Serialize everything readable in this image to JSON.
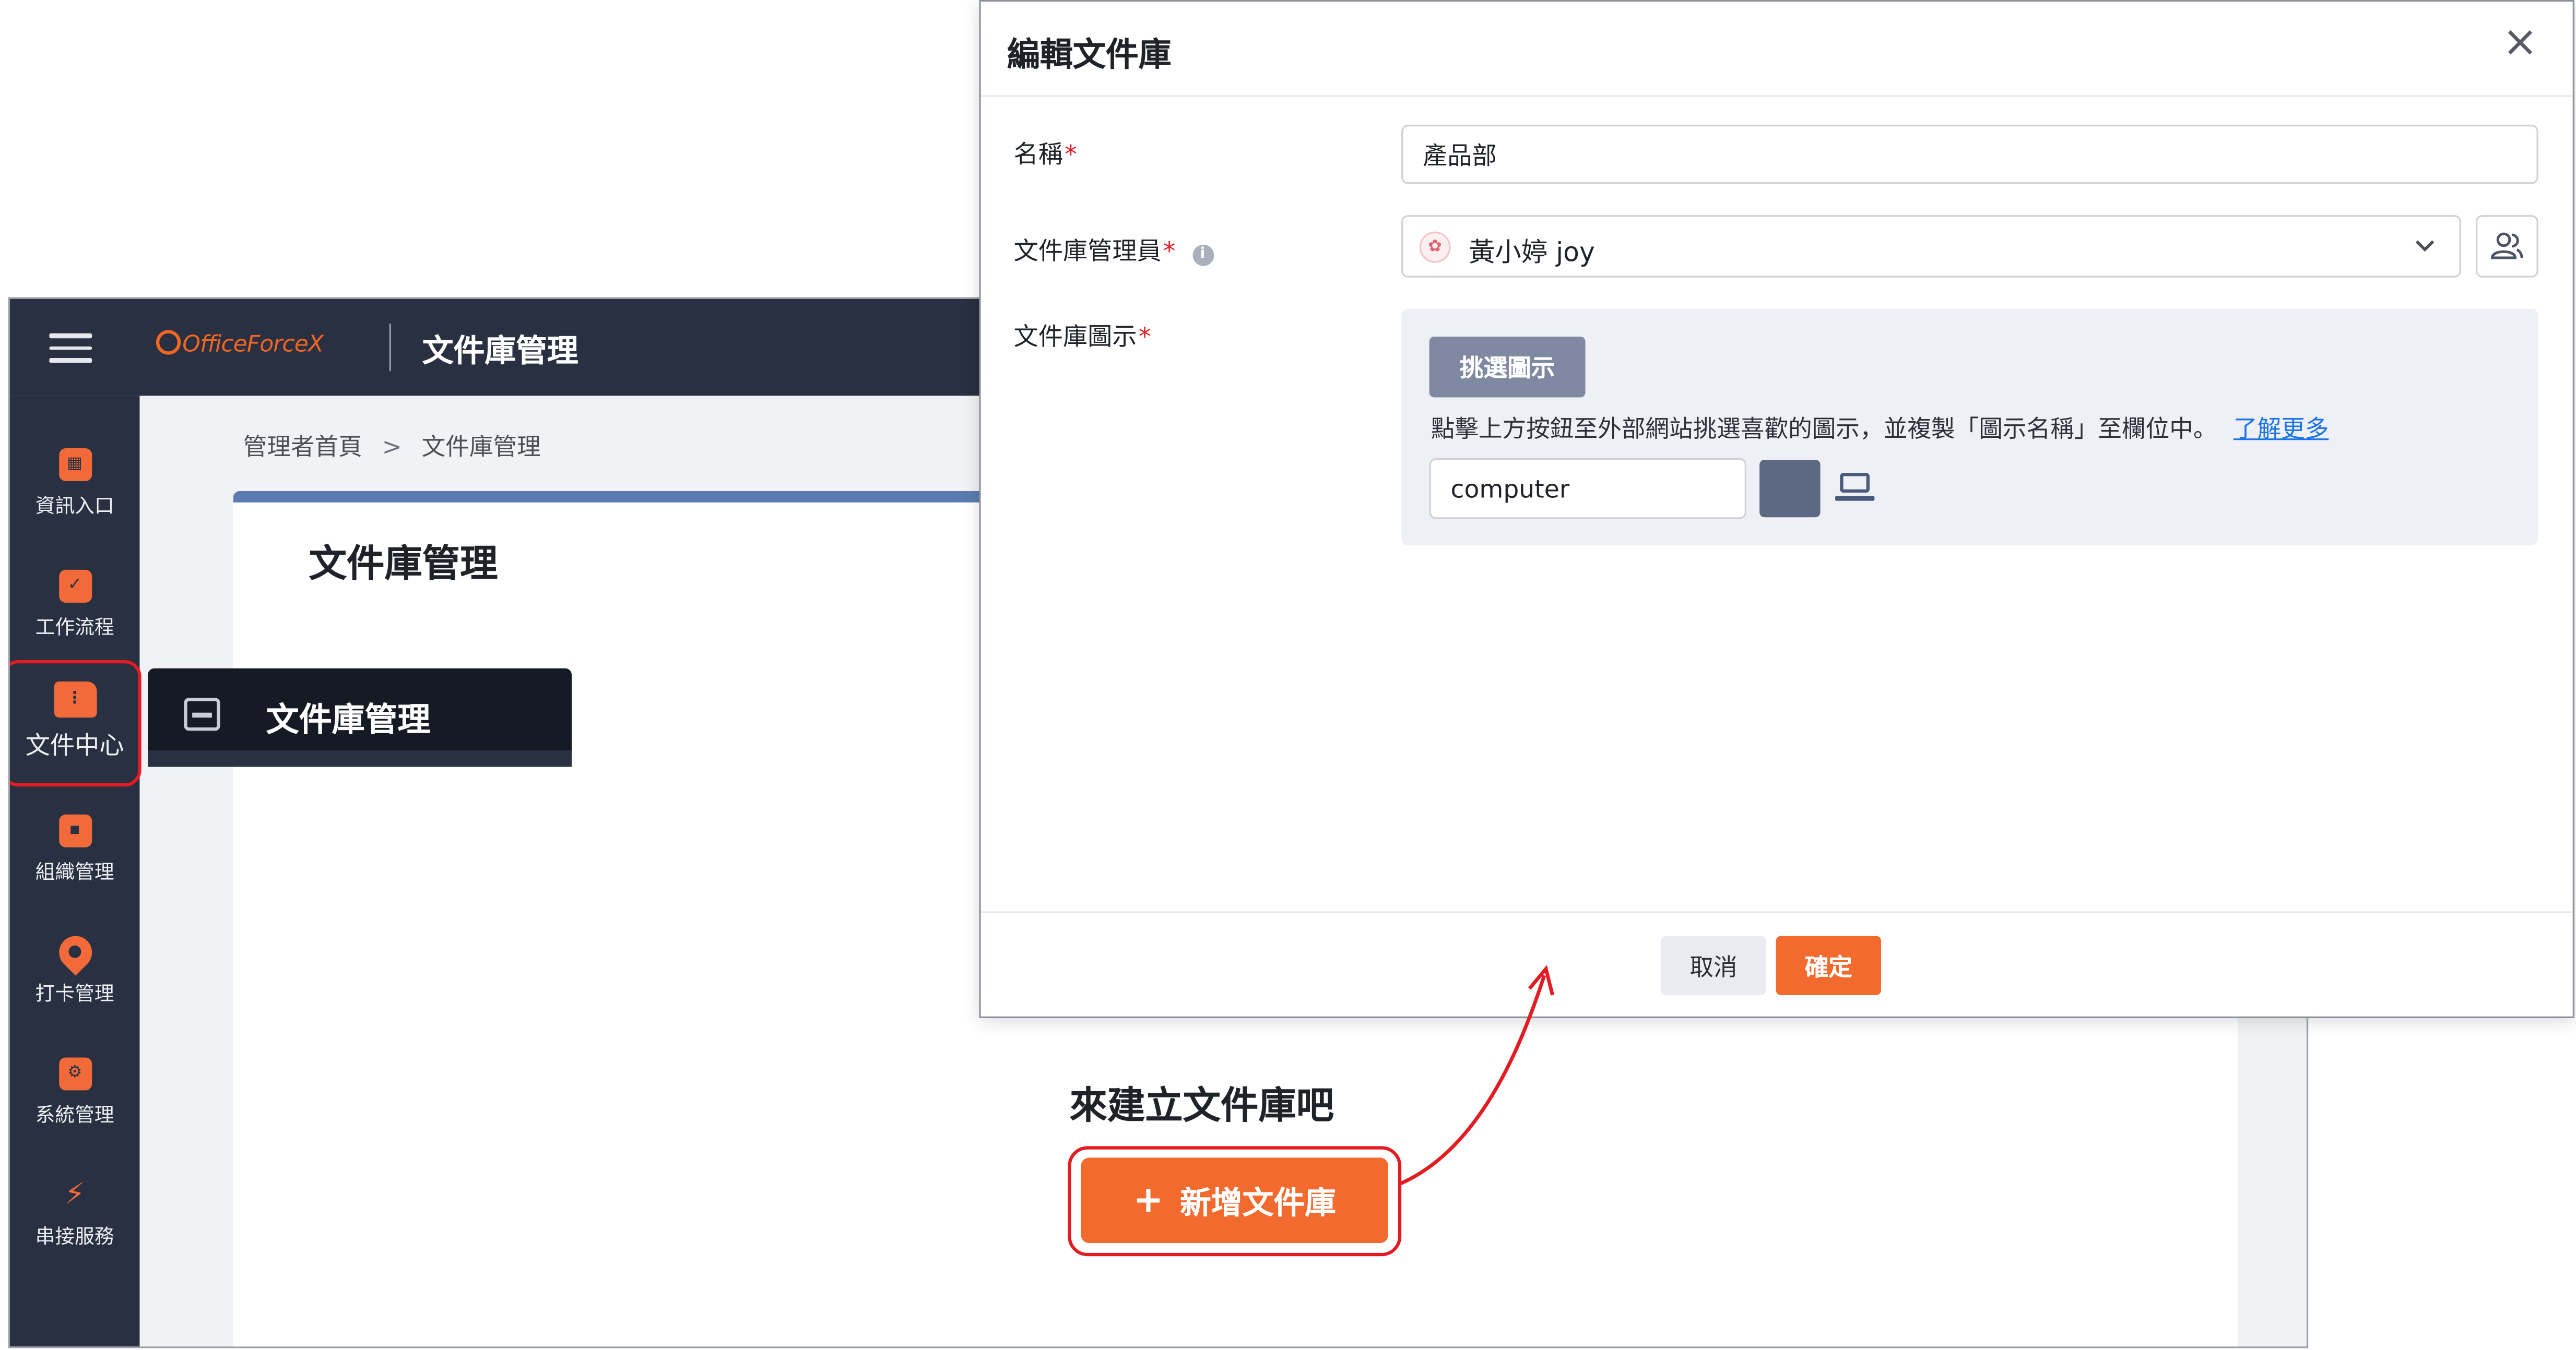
{
  "app": {
    "brand": "OfficeForceX",
    "page_title": "文件庫管理"
  },
  "sidebar": {
    "items": [
      {
        "label": "資訊入口",
        "icon": "dashboard-icon"
      },
      {
        "label": "工作流程",
        "icon": "clipboard-check-icon"
      },
      {
        "label": "文件中心",
        "icon": "folder-icon"
      },
      {
        "label": "組織管理",
        "icon": "organization-icon"
      },
      {
        "label": "打卡管理",
        "icon": "location-pin-icon"
      },
      {
        "label": "系統管理",
        "icon": "settings-monitor-icon"
      },
      {
        "label": "串接服務",
        "icon": "plug-icon"
      }
    ],
    "submenu": {
      "label": "文件庫管理",
      "icon": "inbox-tray-icon"
    }
  },
  "breadcrumb": {
    "home": "管理者首頁",
    "separator": ">",
    "current": "文件庫管理"
  },
  "main": {
    "title": "文件庫管理",
    "empty_text": "來建立文件庫吧",
    "add_button_plus": "+",
    "add_button": "新增文件庫"
  },
  "dialog": {
    "title": "編輯文件庫",
    "close": "×",
    "required_mark": "*",
    "name_label": "名稱",
    "name_value": "產品部",
    "admin_label": "文件庫管理員",
    "admin_value": "黃小婷  joy",
    "icon_label": "文件庫圖示",
    "pick_icon_button": "挑選圖示",
    "icon_hint": "點擊上方按鈕至外部網站挑選喜歡的圖示，並複製「圖示名稱」至欄位中。",
    "learn_more": "了解更多",
    "icon_value": "computer",
    "icon_preview": "laptop-icon",
    "cancel": "取消",
    "confirm": "確定"
  },
  "colors": {
    "accent": "#f26a2e",
    "sidebar_bg": "#283041",
    "highlight_ring": "#e31b23",
    "link": "#1a73e8",
    "icon_color": "#5d6883"
  }
}
